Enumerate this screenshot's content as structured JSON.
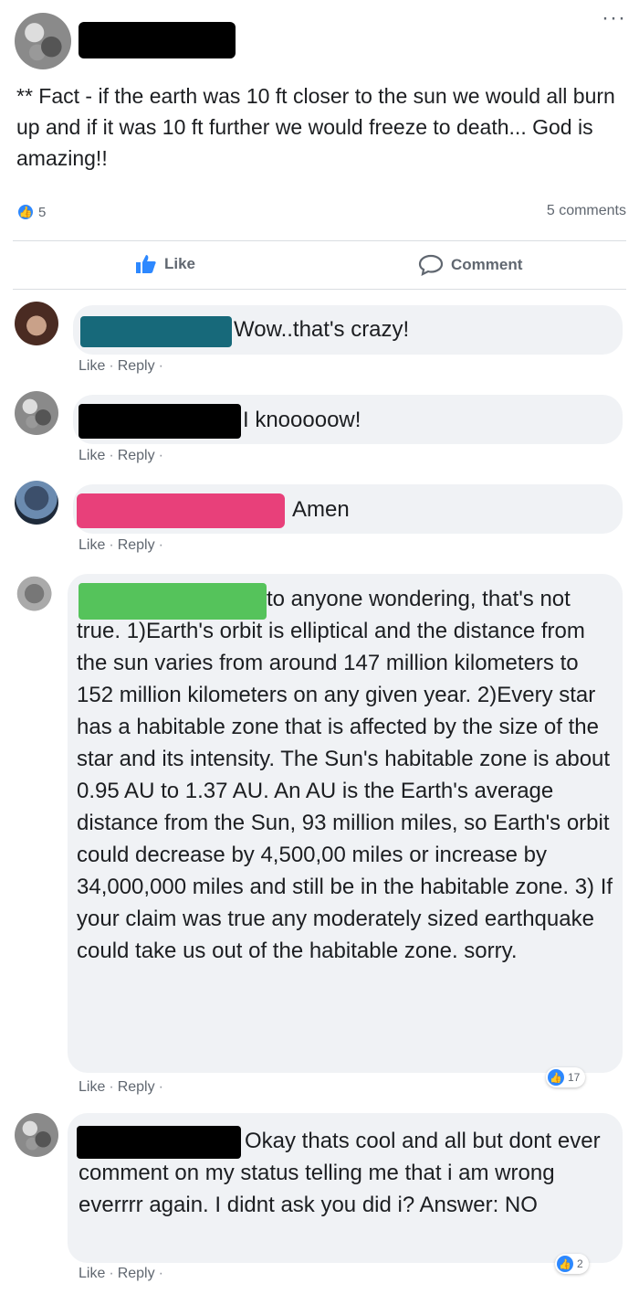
{
  "post": {
    "text": "** Fact - if the earth was 10 ft closer to the sun we would all burn up and if it was 10 ft further we would freeze to death... God is amazing!!",
    "like_count": "5",
    "comments_count": "5 comments"
  },
  "actions": {
    "like_label": "Like",
    "comment_label": "Comment"
  },
  "comments": [
    {
      "text": "Wow..that's crazy!",
      "like": "Like",
      "reply": "Reply",
      "dot": "·"
    },
    {
      "text": "I knooooow!",
      "like": "Like",
      "reply": "Reply",
      "dot": "·"
    },
    {
      "text": "Amen",
      "like": "Like",
      "reply": "Reply",
      "dot": "·"
    },
    {
      "text": "to anyone wondering, that's not true. 1)Earth's orbit is elliptical and the distance from the sun varies from around 147 million kilometers to 152 million kilometers on any given year. 2)Every star has a habitable zone that is affected by the size of the star and its intensity. The Sun's habitable zone is about 0.95 AU to 1.37 AU. An AU is the Earth's average distance from the Sun, 93 million miles, so Earth's orbit could decrease by 4,500,00 miles or increase by 34,000,000 miles and still be in the habitable zone. 3) If your claim was true any moderately sized earthquake could take us out of the habitable zone. sorry.",
      "like": "Like",
      "reply": "Reply",
      "dot": "·",
      "reactions": "17"
    },
    {
      "text": "Okay thats cool and all but dont ever comment on my status telling me that i am wrong everrrr again. I didnt ask you did i? Answer: NO",
      "like": "Like",
      "reply": "Reply",
      "dot": "·",
      "reactions": "2"
    }
  ],
  "colors": {
    "redact_black": "#000000",
    "redact_teal": "#17697a",
    "redact_pink": "#e8407a",
    "redact_green": "#55c35b",
    "like_blue": "#2d88ff"
  }
}
